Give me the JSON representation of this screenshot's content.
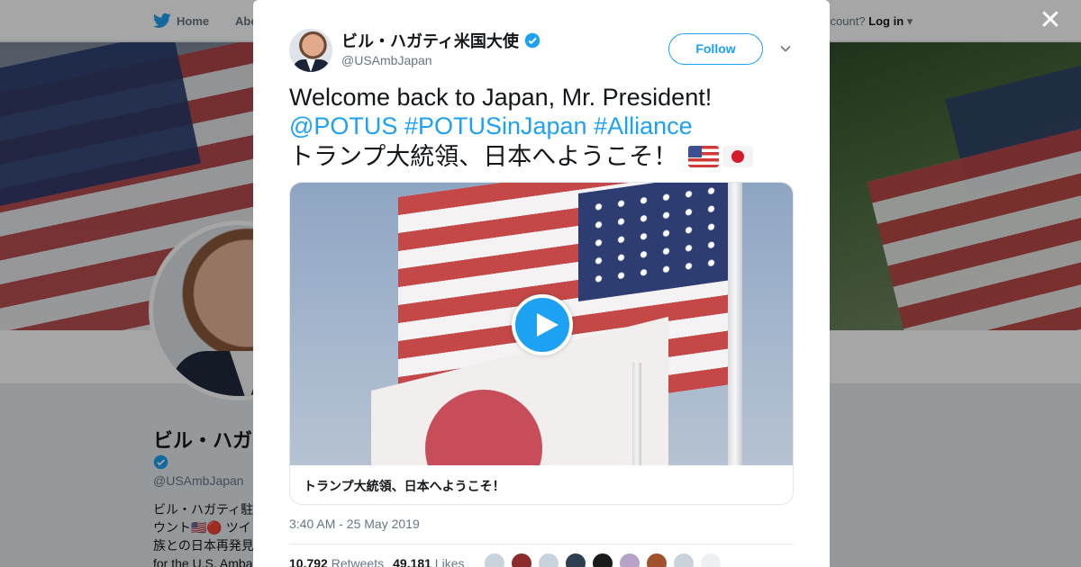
{
  "nav": {
    "home_label": "Home",
    "about_label": "Abo",
    "account_prompt": "ccount?",
    "login_label": "Log in"
  },
  "profile": {
    "name": "ビル・ハガ",
    "handle": "@USAmbJapan",
    "bio": "ビル・ハガティ駐\nウント🇺🇸🔴 ツイ\n族との日本再発見\nfor the U.S. Amba"
  },
  "tweet": {
    "author_name": "ビル・ハガティ米国大使",
    "author_handle": "@USAmbJapan",
    "follow_label": "Follow",
    "text_line1": "Welcome back to Japan, Mr. President!",
    "mention": "@POTUS",
    "hashtag1": "#POTUSinJapan",
    "hashtag2": "#Alliance",
    "text_line3": "トランプ大統領、日本へようこそ！",
    "media_caption": "トランプ大統領、日本へようこそ！",
    "timestamp": "3:40 AM - 25 May 2019",
    "retweets_count": "10,792",
    "retweets_label": "Retweets",
    "likes_count": "49,181",
    "likes_label": "Likes"
  },
  "colors": {
    "accent": "#1da1f2",
    "text": "#14171a",
    "secondary": "#657786"
  },
  "icons": {
    "close": "close-icon",
    "verified": "verified-badge-icon",
    "caret": "chevron-down-icon",
    "play": "play-icon",
    "bird": "twitter-bird-icon"
  }
}
